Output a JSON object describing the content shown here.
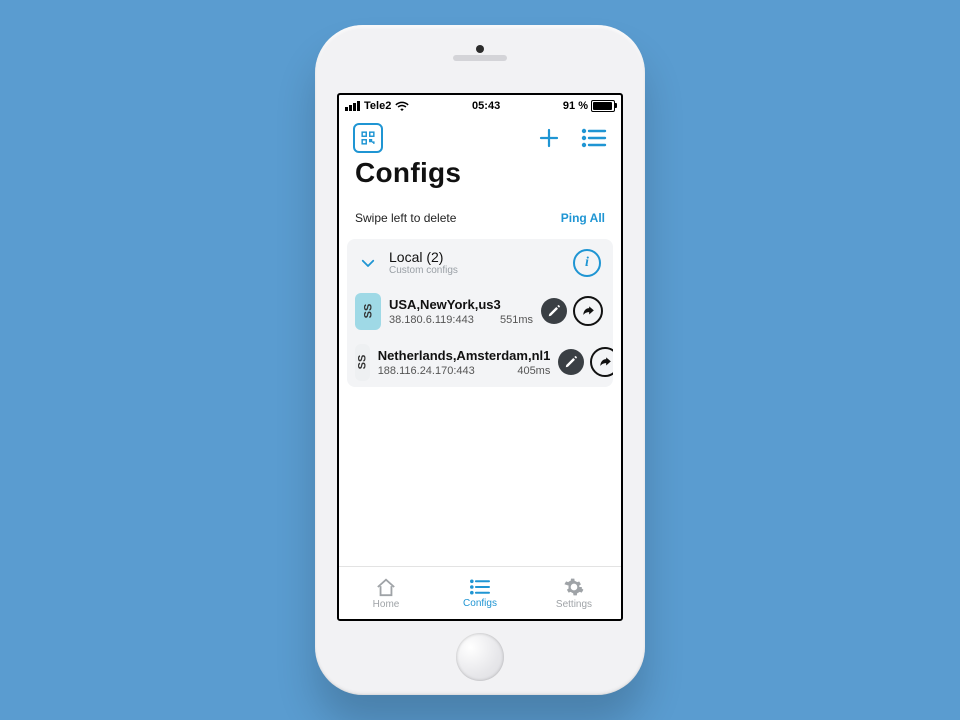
{
  "status": {
    "carrier": "Tele2",
    "time": "05:43",
    "battery_text": "91 %"
  },
  "nav": {
    "title": "Configs"
  },
  "hint": {
    "swipe": "Swipe left to delete",
    "ping_all": "Ping All"
  },
  "group": {
    "name": "Local (2)",
    "subtitle": "Custom configs"
  },
  "rows": [
    {
      "proto": "SS",
      "name": "USA,NewYork,us3",
      "addr": "38.180.6.119:443",
      "ping": "551ms",
      "active": true
    },
    {
      "proto": "SS",
      "name": "Netherlands,Amsterdam,nl1",
      "addr": "188.116.24.170:443",
      "ping": "405ms",
      "active": false
    }
  ],
  "tabs": {
    "home": "Home",
    "configs": "Configs",
    "settings": "Settings"
  }
}
